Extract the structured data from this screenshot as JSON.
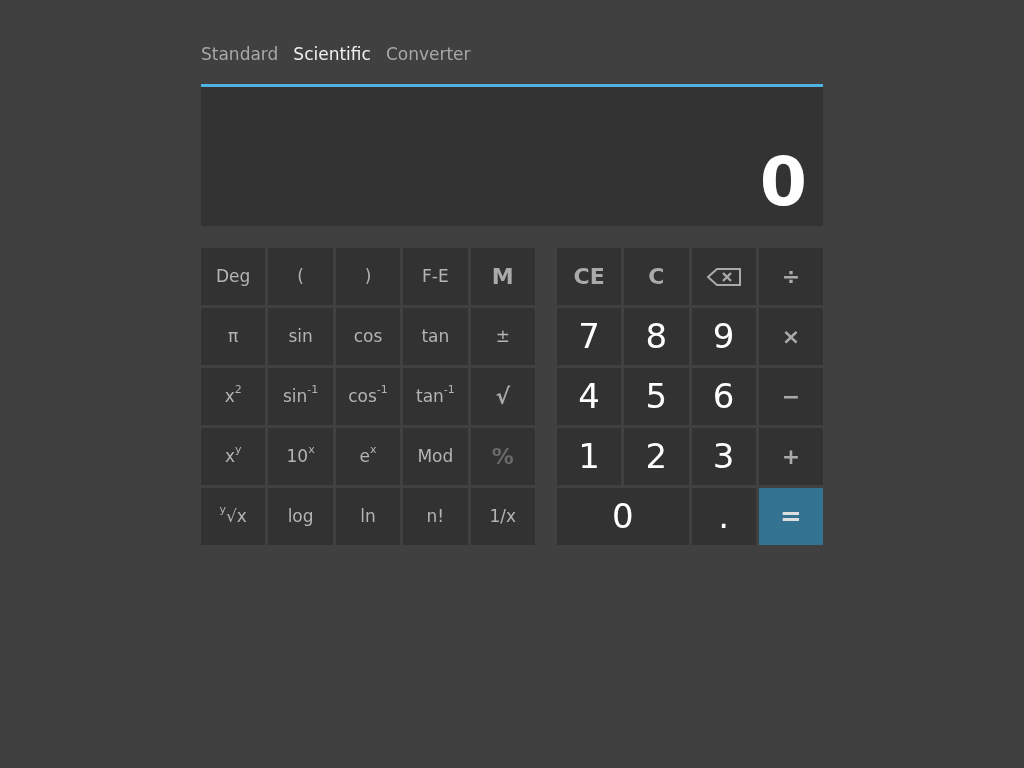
{
  "tabs": [
    {
      "label": "Standard",
      "selected": false
    },
    {
      "label": "Scientific",
      "selected": true
    },
    {
      "label": "Converter",
      "selected": false
    }
  ],
  "display": {
    "value": "0"
  },
  "scientific_keys": [
    {
      "label": "Deg",
      "kind": "fn",
      "disabled": false
    },
    {
      "label": "(",
      "kind": "fn",
      "disabled": false
    },
    {
      "label": ")",
      "kind": "fn",
      "disabled": false
    },
    {
      "label": "F-E",
      "kind": "fn",
      "disabled": false
    },
    {
      "label": "M",
      "kind": "op",
      "disabled": false
    },
    {
      "label": "π",
      "kind": "fn",
      "disabled": false
    },
    {
      "label": "sin",
      "kind": "fn",
      "disabled": false
    },
    {
      "label": "cos",
      "kind": "fn",
      "disabled": false
    },
    {
      "label": "tan",
      "kind": "fn",
      "disabled": false
    },
    {
      "label": "±",
      "kind": "fn",
      "disabled": false
    },
    {
      "label": "x$^{2}$",
      "kind": "fn",
      "disabled": false
    },
    {
      "label": "sin$^{-1}$",
      "kind": "fn",
      "disabled": false
    },
    {
      "label": "cos$^{-1}$",
      "kind": "fn",
      "disabled": false
    },
    {
      "label": "tan$^{-1}$",
      "kind": "fn",
      "disabled": false
    },
    {
      "label": "√",
      "kind": "op",
      "disabled": false
    },
    {
      "label": "x$^{y}$",
      "kind": "fn",
      "disabled": false
    },
    {
      "label": "10$^{x}$",
      "kind": "fn",
      "disabled": false
    },
    {
      "label": "e$^{x}$",
      "kind": "fn",
      "disabled": false
    },
    {
      "label": "Mod",
      "kind": "fn",
      "disabled": false
    },
    {
      "label": "%",
      "kind": "op",
      "disabled": true
    },
    {
      "label": "$^{y}$√x",
      "kind": "fn",
      "disabled": false
    },
    {
      "label": "log",
      "kind": "fn",
      "disabled": false
    },
    {
      "label": "ln",
      "kind": "fn",
      "disabled": false
    },
    {
      "label": "n!",
      "kind": "fn",
      "disabled": false
    },
    {
      "label": "1/x",
      "kind": "fn",
      "disabled": false
    }
  ],
  "standard_keys": [
    {
      "label": "CE",
      "kind": "op"
    },
    {
      "label": "C",
      "kind": "op"
    },
    {
      "kind": "backspace"
    },
    {
      "label": "÷",
      "kind": "op"
    },
    {
      "label": "7",
      "kind": "digit"
    },
    {
      "label": "8",
      "kind": "digit"
    },
    {
      "label": "9",
      "kind": "digit"
    },
    {
      "label": "×",
      "kind": "op"
    },
    {
      "label": "4",
      "kind": "digit"
    },
    {
      "label": "5",
      "kind": "digit"
    },
    {
      "label": "6",
      "kind": "digit"
    },
    {
      "label": "−",
      "kind": "op"
    },
    {
      "label": "1",
      "kind": "digit"
    },
    {
      "label": "2",
      "kind": "digit"
    },
    {
      "label": "3",
      "kind": "digit"
    },
    {
      "label": "+",
      "kind": "op"
    },
    {
      "label": "0",
      "kind": "digit",
      "wide": true
    },
    {
      "label": ".",
      "kind": "digit"
    },
    {
      "label": "=",
      "kind": "equals"
    }
  ]
}
